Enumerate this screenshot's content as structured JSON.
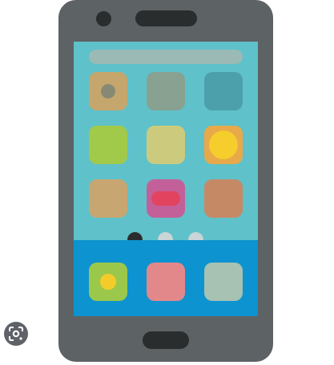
{
  "icons": {
    "phone": "smartphone-illustration",
    "lens": "google-lens-icon"
  },
  "colors": {
    "phone_body": "#5d6264",
    "screen": "#5fc1ca",
    "dock": "#0d93cf",
    "search_bar": "#9bbab6"
  },
  "screen": {
    "pager": {
      "active_page": 1,
      "total_pages": 3
    }
  }
}
